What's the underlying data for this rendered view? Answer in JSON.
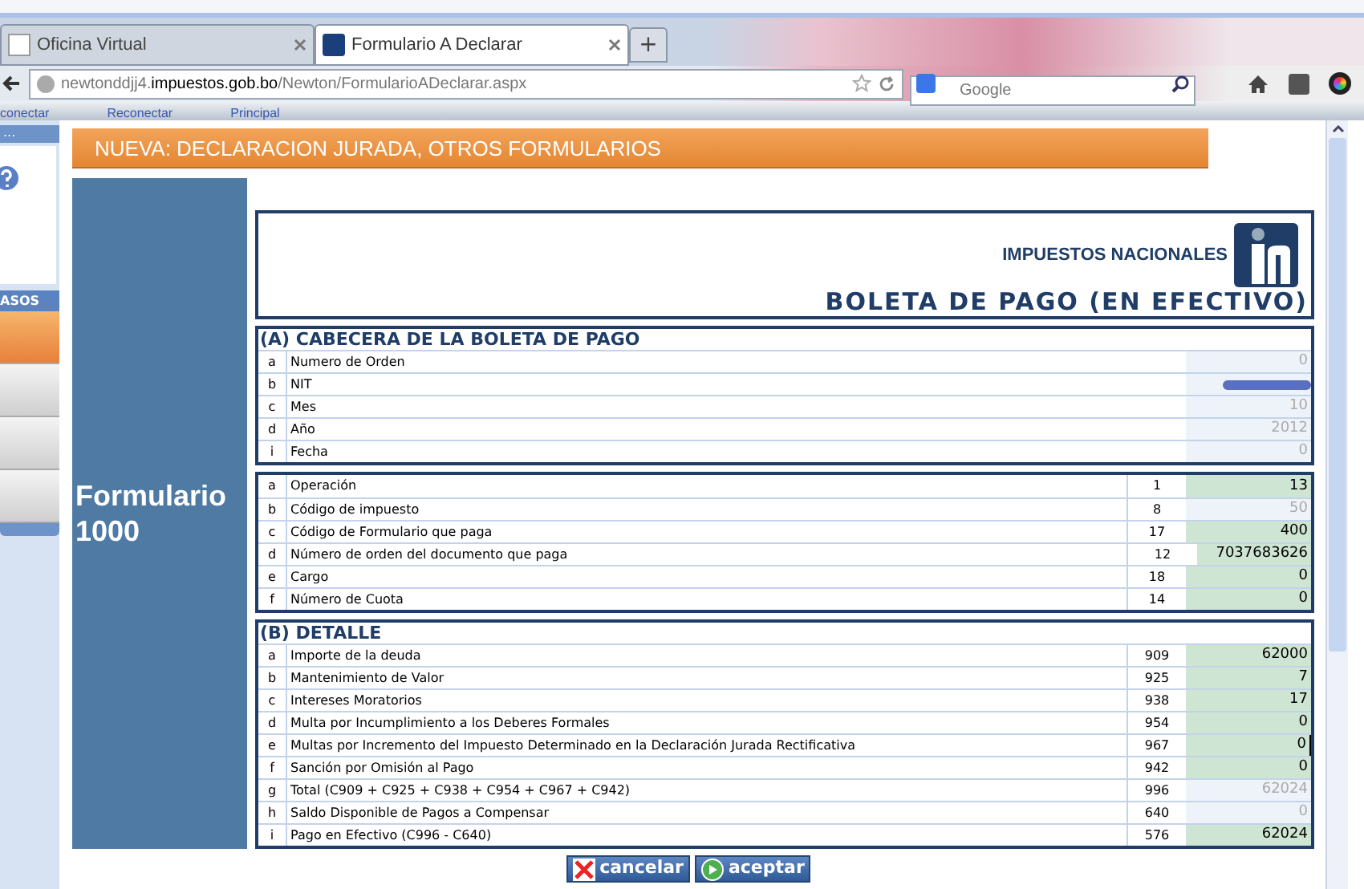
{
  "browser": {
    "tabs": [
      {
        "title": "Oficina Virtual",
        "selected": false
      },
      {
        "title": "Formulario A Declarar",
        "selected": true
      }
    ],
    "new_tab": "+",
    "url_host": "newtonddjj4.",
    "url_domain": "impuestos.gob.bo",
    "url_path": "/Newton/FormularioADeclarar.aspx",
    "search_placeholder": "Google"
  },
  "top_links": [
    "conectar",
    "Reconectar",
    "Principal"
  ],
  "sidebar": {
    "header": "...",
    "section": "ASOS",
    "items": [
      {
        "selected": true
      },
      {
        "selected": false
      },
      {
        "selected": false
      },
      {
        "selected": false
      }
    ]
  },
  "page_title": "NUEVA: DECLARACION JURADA, OTROS FORMULARIOS",
  "form_name": "Formulario 1000",
  "agency": "IMPUESTOS NACIONALES",
  "form_title": "BOLETA DE PAGO (EN EFECTIVO)",
  "sections": [
    {
      "title": "(A) CABECERA DE LA BOLETA DE PAGO",
      "rows": [
        {
          "letter": "a",
          "label": "Numero de Orden",
          "value": "0",
          "editable": false
        },
        {
          "letter": "b",
          "label": "NIT",
          "value": "",
          "editable": false,
          "redacted": true
        },
        {
          "letter": "c",
          "label": "Mes",
          "value": "10",
          "editable": false
        },
        {
          "letter": "d",
          "label": "Año",
          "value": "2012",
          "editable": false
        },
        {
          "letter": "i",
          "label": "Fecha",
          "value": "0",
          "editable": false
        }
      ]
    },
    {
      "rows": [
        {
          "letter": "a",
          "label": "Operación",
          "code": "1",
          "value": "13",
          "editable": true
        },
        {
          "letter": "b",
          "label": "Código de impuesto",
          "code": "8",
          "value": "50",
          "editable": false
        },
        {
          "letter": "c",
          "label": "Código de Formulario que paga",
          "code": "17",
          "value": "400",
          "editable": true
        },
        {
          "letter": "d",
          "label": "Número de orden del documento que paga",
          "code": "12",
          "value": "7037683626",
          "editable": true,
          "wide": true
        },
        {
          "letter": "e",
          "label": "Cargo",
          "code": "18",
          "value": "0",
          "editable": true
        },
        {
          "letter": "f",
          "label": "Número de Cuota",
          "code": "14",
          "value": "0",
          "editable": true
        }
      ]
    },
    {
      "title": "(B) DETALLE",
      "rows": [
        {
          "letter": "a",
          "label": "Importe de la deuda",
          "code": "909",
          "value": "62000",
          "editable": true
        },
        {
          "letter": "b",
          "label": "Mantenimiento de Valor",
          "code": "925",
          "value": "7",
          "editable": true
        },
        {
          "letter": "c",
          "label": "Intereses Moratorios",
          "code": "938",
          "value": "17",
          "editable": true
        },
        {
          "letter": "d",
          "label": "Multa por Incumplimiento a los Deberes Formales",
          "code": "954",
          "value": "0",
          "editable": true
        },
        {
          "letter": "e",
          "label": "Multas por Incremento del Impuesto Determinado en la Declaración Jurada Rectificativa",
          "code": "967",
          "value": "0",
          "editable": true,
          "focused": true
        },
        {
          "letter": "f",
          "label": "Sanción por Omisión al Pago",
          "code": "942",
          "value": "0",
          "editable": true
        },
        {
          "letter": "g",
          "label": "Total (C909 + C925 + C938 + C954 + C967 + C942)",
          "code": "996",
          "value": "62024",
          "editable": false
        },
        {
          "letter": "h",
          "label": "Saldo Disponible de Pagos a Compensar",
          "code": "640",
          "value": "0",
          "editable": false
        },
        {
          "letter": "i",
          "label": "Pago en Efectivo (C996 - C640)",
          "code": "576",
          "value": "62024",
          "editable": true
        }
      ]
    }
  ],
  "buttons": [
    {
      "kind": "cancel",
      "label": "cancelar"
    },
    {
      "kind": "accept",
      "label": "aceptar"
    }
  ]
}
